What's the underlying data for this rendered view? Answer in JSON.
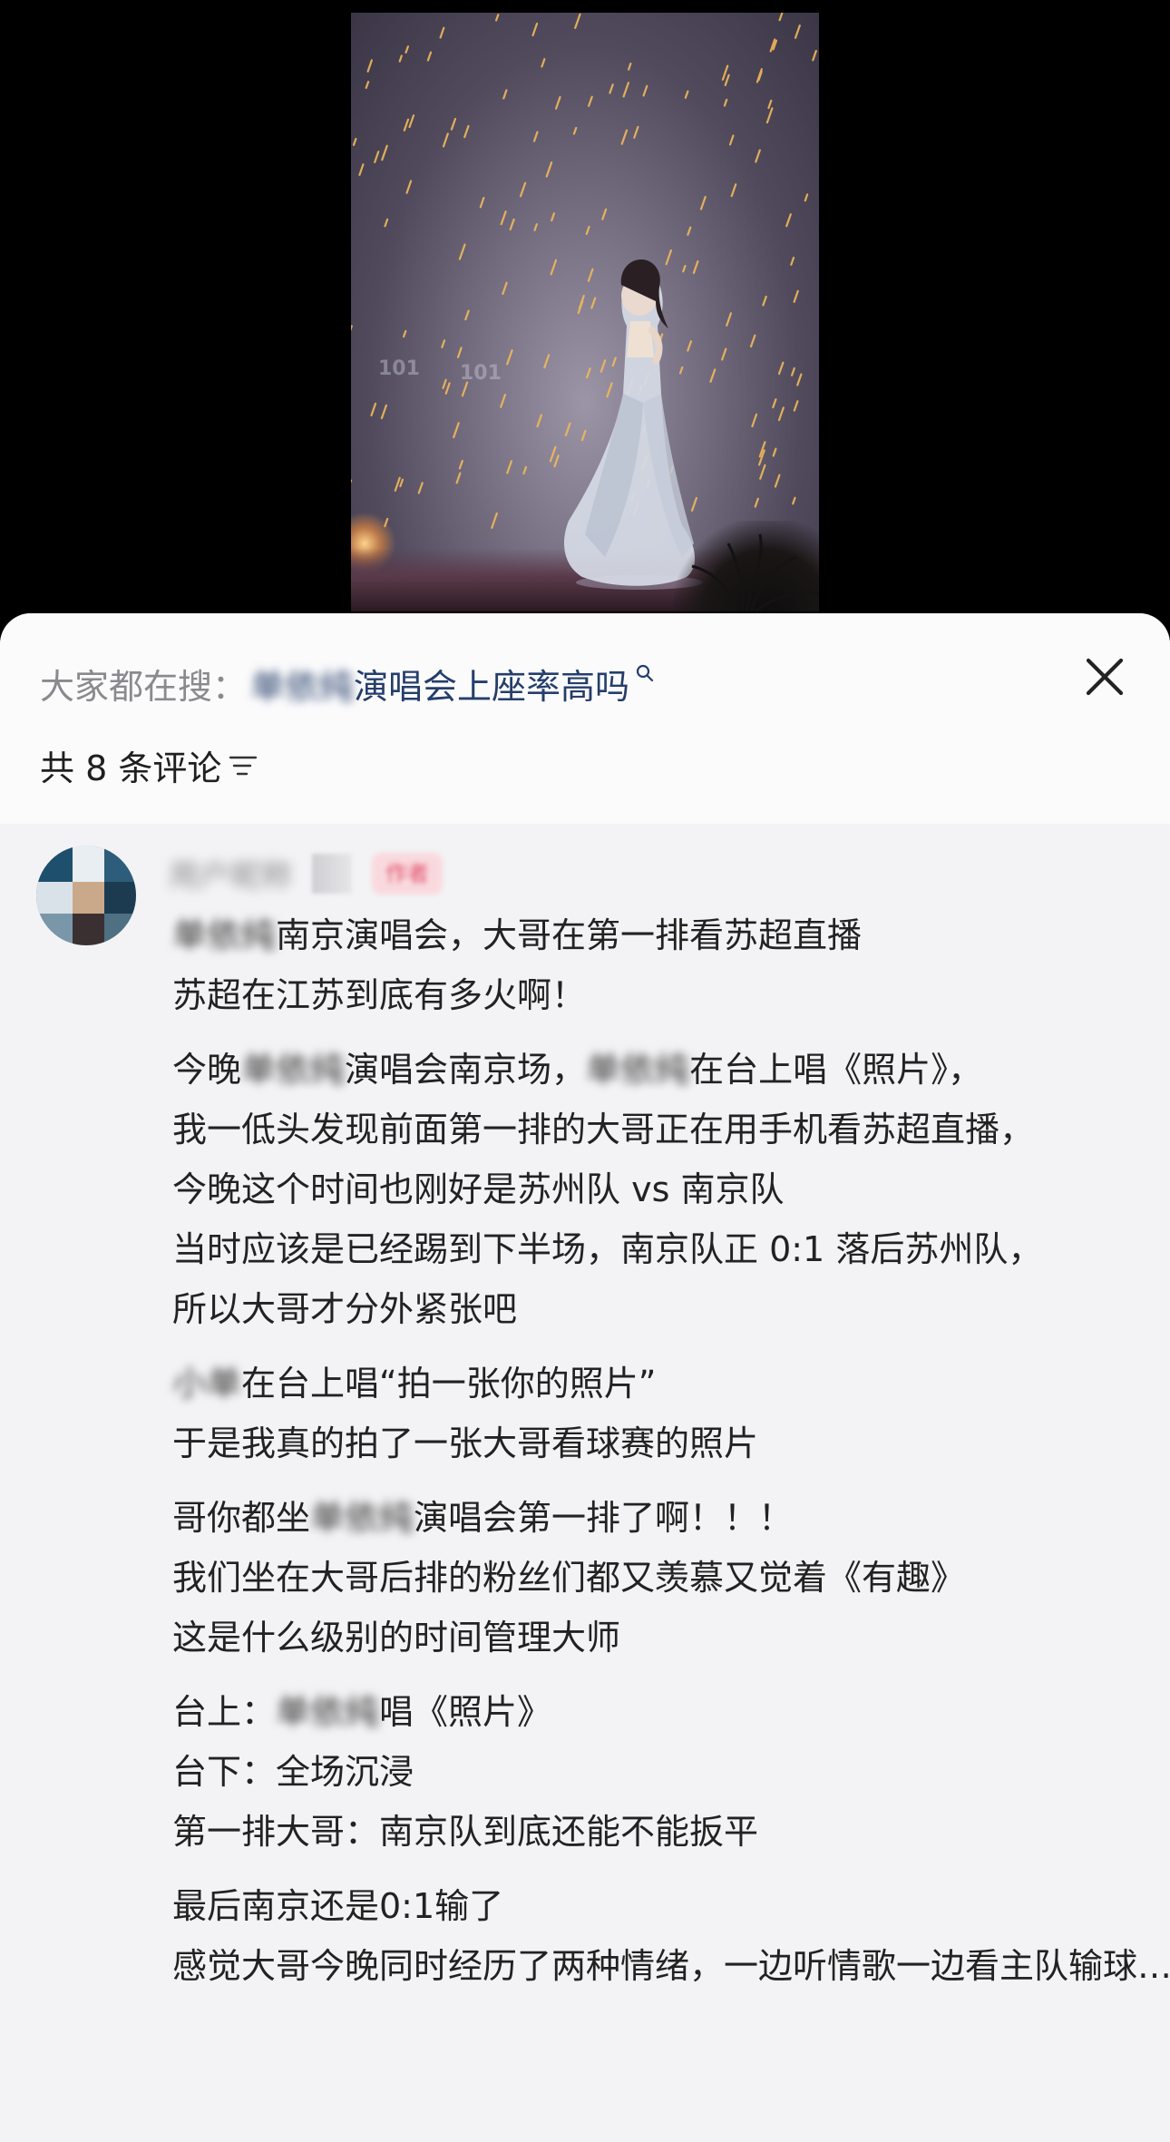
{
  "search": {
    "prefix": "大家都在搜：",
    "query_visible": "演唱会上座率高吗",
    "query_obscured": "单依纯"
  },
  "comments_header": {
    "count_label": "共 8 条评论"
  },
  "comment": {
    "username": "用户昵称",
    "badge": "作者",
    "paragraphs": [
      [
        {
          "pre": "单依纯",
          "text": "南京演唱会，大哥在第一排看苏超直播"
        },
        {
          "text": "苏超在江苏到底有多火啊！"
        }
      ],
      [
        {
          "text": "今晚",
          "blur": "单依纯",
          "text2": "演唱会南京场，",
          "blur2": "单依纯",
          "text3": "在台上唱《照片》，"
        },
        {
          "text": "我一低头发现前面第一排的大哥正在用手机看苏超直播，"
        },
        {
          "text": "今晚这个时间也刚好是苏州队 vs 南京队"
        },
        {
          "text": "当时应该是已经踢到下半场，南京队正 0:1 落后苏州队，"
        },
        {
          "text": "所以大哥才分外紧张吧"
        }
      ],
      [
        {
          "pre": "小单",
          "text": "在台上唱“拍一张你的照片”"
        },
        {
          "text": "于是我真的拍了一张大哥看球赛的照片"
        }
      ],
      [
        {
          "text": "哥你都坐",
          "blur": "单依纯",
          "text2": "演唱会第一排了啊！！！"
        },
        {
          "text": "我们坐在大哥后排的粉丝们都又羡慕又觉着《有趣》"
        },
        {
          "text": "这是什么级别的时间管理大师"
        }
      ],
      [
        {
          "text": "台上：",
          "blur": "单依纯",
          "text2": "唱《照片》"
        },
        {
          "text": "台下：全场沉浸"
        },
        {
          "text": "第一排大哥：南京队到底还能不能扳平"
        }
      ],
      [
        {
          "text": "最后南京还是0:1输了"
        },
        {
          "text": "感觉大哥今晚同时经历了两种情绪，一边听情歌一边看主队输球……"
        }
      ]
    ]
  },
  "icons": {
    "close": "close-icon",
    "sort": "sort-icon",
    "search": "search-icon"
  }
}
